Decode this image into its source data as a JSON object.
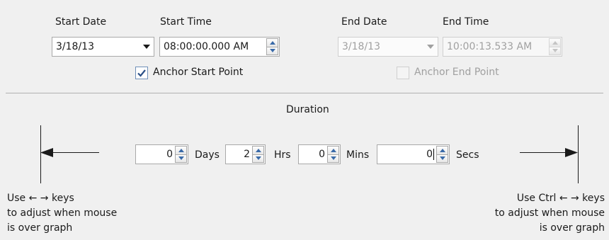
{
  "start": {
    "date_label": "Start Date",
    "time_label": "Start Time",
    "date_value": "3/18/13",
    "time_value": "08:00:00.000 AM",
    "anchor_label": "Anchor Start Point",
    "anchor_checked": true
  },
  "end": {
    "date_label": "End Date",
    "time_label": "End Time",
    "date_value": "3/18/13",
    "time_value": "10:00:13.533 AM",
    "anchor_label": "Anchor End Point",
    "anchor_checked": false
  },
  "duration": {
    "title": "Duration",
    "days_value": "0",
    "days_label": "Days",
    "hrs_value": "2",
    "hrs_label": "Hrs",
    "mins_value": "0",
    "mins_label": "Mins",
    "secs_value": "0",
    "secs_label": "Secs"
  },
  "hints": {
    "left_line1": "Use ← → keys",
    "left_line2": "to adjust when mouse",
    "left_line3": "is over graph",
    "right_line1": "Use Ctrl ← → keys",
    "right_line2": "to adjust when mouse",
    "right_line3": "is over graph"
  },
  "colors": {
    "background": "#f0f0f0",
    "accent": "#3a6aa8",
    "disabled_text": "#a0a0a0"
  }
}
